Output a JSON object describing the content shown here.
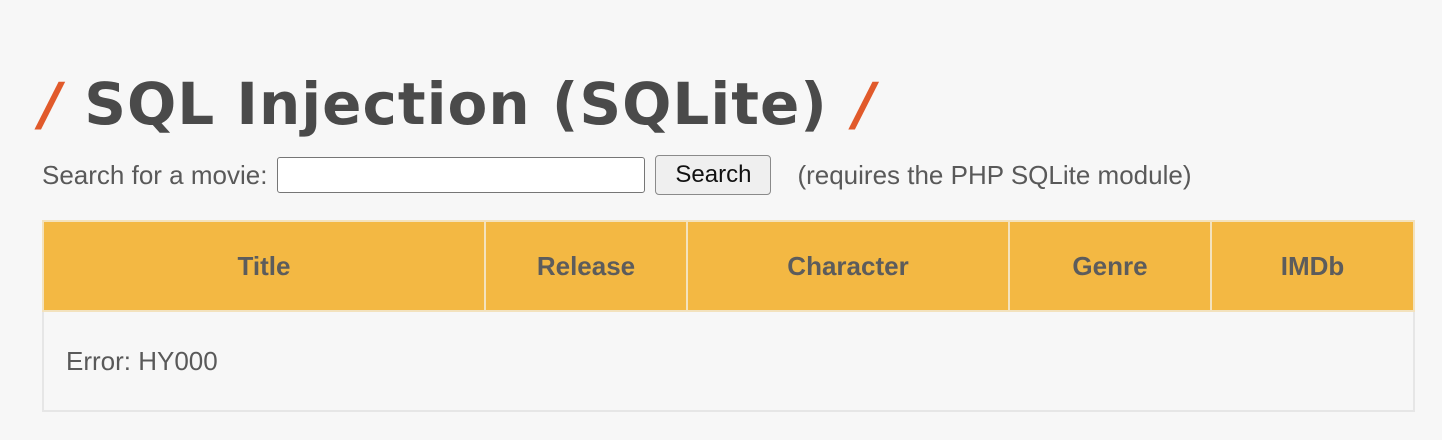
{
  "page_title": {
    "left_slash": "/",
    "text": "SQL Injection (SQLite)",
    "right_slash": "/"
  },
  "search": {
    "label": "Search for a movie:",
    "value": "",
    "placeholder": "",
    "button_label": "Search",
    "note": "(requires the PHP SQLite module)"
  },
  "table": {
    "columns": [
      "Title",
      "Release",
      "Character",
      "Genre",
      "IMDb"
    ],
    "message": "Error: HY000"
  },
  "colors": {
    "accent": "#e15a2b",
    "header_bg": "#f3b843",
    "page_bg": "#f7f7f7"
  }
}
